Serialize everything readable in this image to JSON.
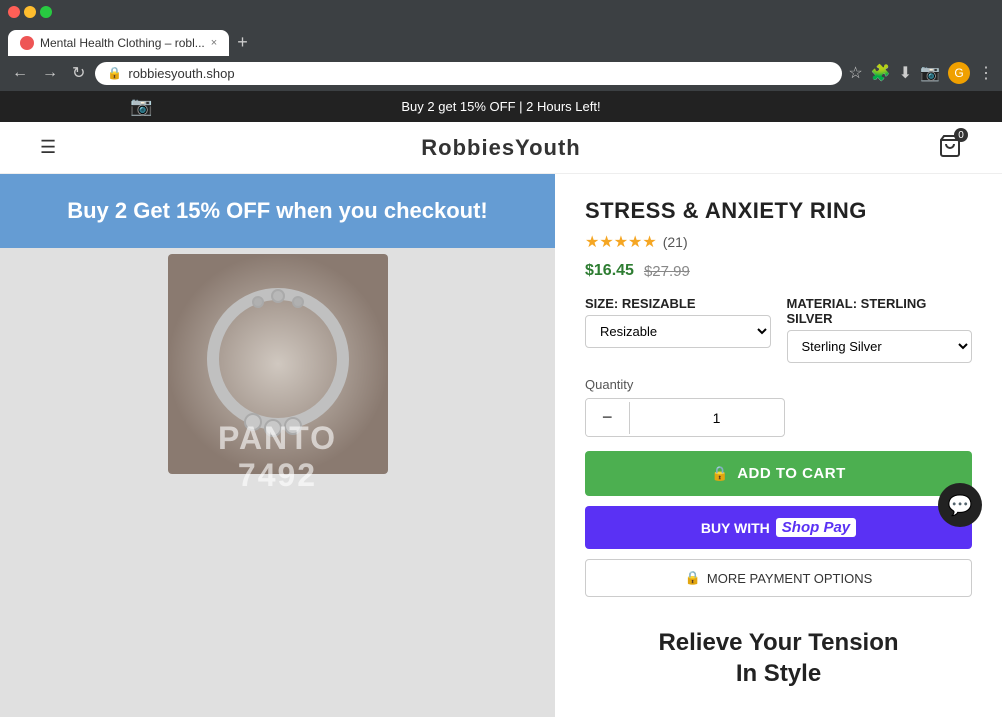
{
  "browser": {
    "tab_favicon": "🔴",
    "tab_title": "Mental Health Clothing – robl...",
    "tab_close": "×",
    "tab_new": "+",
    "back_btn": "←",
    "forward_btn": "→",
    "refresh_btn": "↻",
    "url": "robbiesyouth.shop",
    "star_icon": "☆",
    "extensions_icon": "🧩",
    "download_icon": "⬇",
    "profile_initials": "G"
  },
  "announcement": {
    "text": "Buy 2 get 15% OFF | 2 Hours Left!"
  },
  "header": {
    "logo": "RobbiesYouth",
    "cart_count": "0"
  },
  "promo_overlay": "Buy 2 Get 15% OFF when you checkout!",
  "product": {
    "title": "STRESS & ANXIETY RING",
    "stars": "★★★★★",
    "review_count": "(21)",
    "price_current": "$16.45",
    "price_original": "$27.99",
    "size_label": "Size:",
    "size_value": "RESIZABLE",
    "material_label": "Material:",
    "material_value": "STERLING SILVER",
    "size_options": [
      "Resizable"
    ],
    "material_options": [
      "Sterling Silver"
    ],
    "quantity_label": "Quantity",
    "quantity_value": "1",
    "qty_minus": "−",
    "qty_plus": "+",
    "add_to_cart_label": "ADD TO CART",
    "buy_now_label": "BUY WITH",
    "shop_pay_label": "Shop Pay",
    "more_payment_label": "MORE PAYMENT OPTIONS",
    "section_heading_line1": "Relieve Your Tension",
    "section_heading_line2": "In Style"
  },
  "chat": {
    "icon": "💬"
  }
}
